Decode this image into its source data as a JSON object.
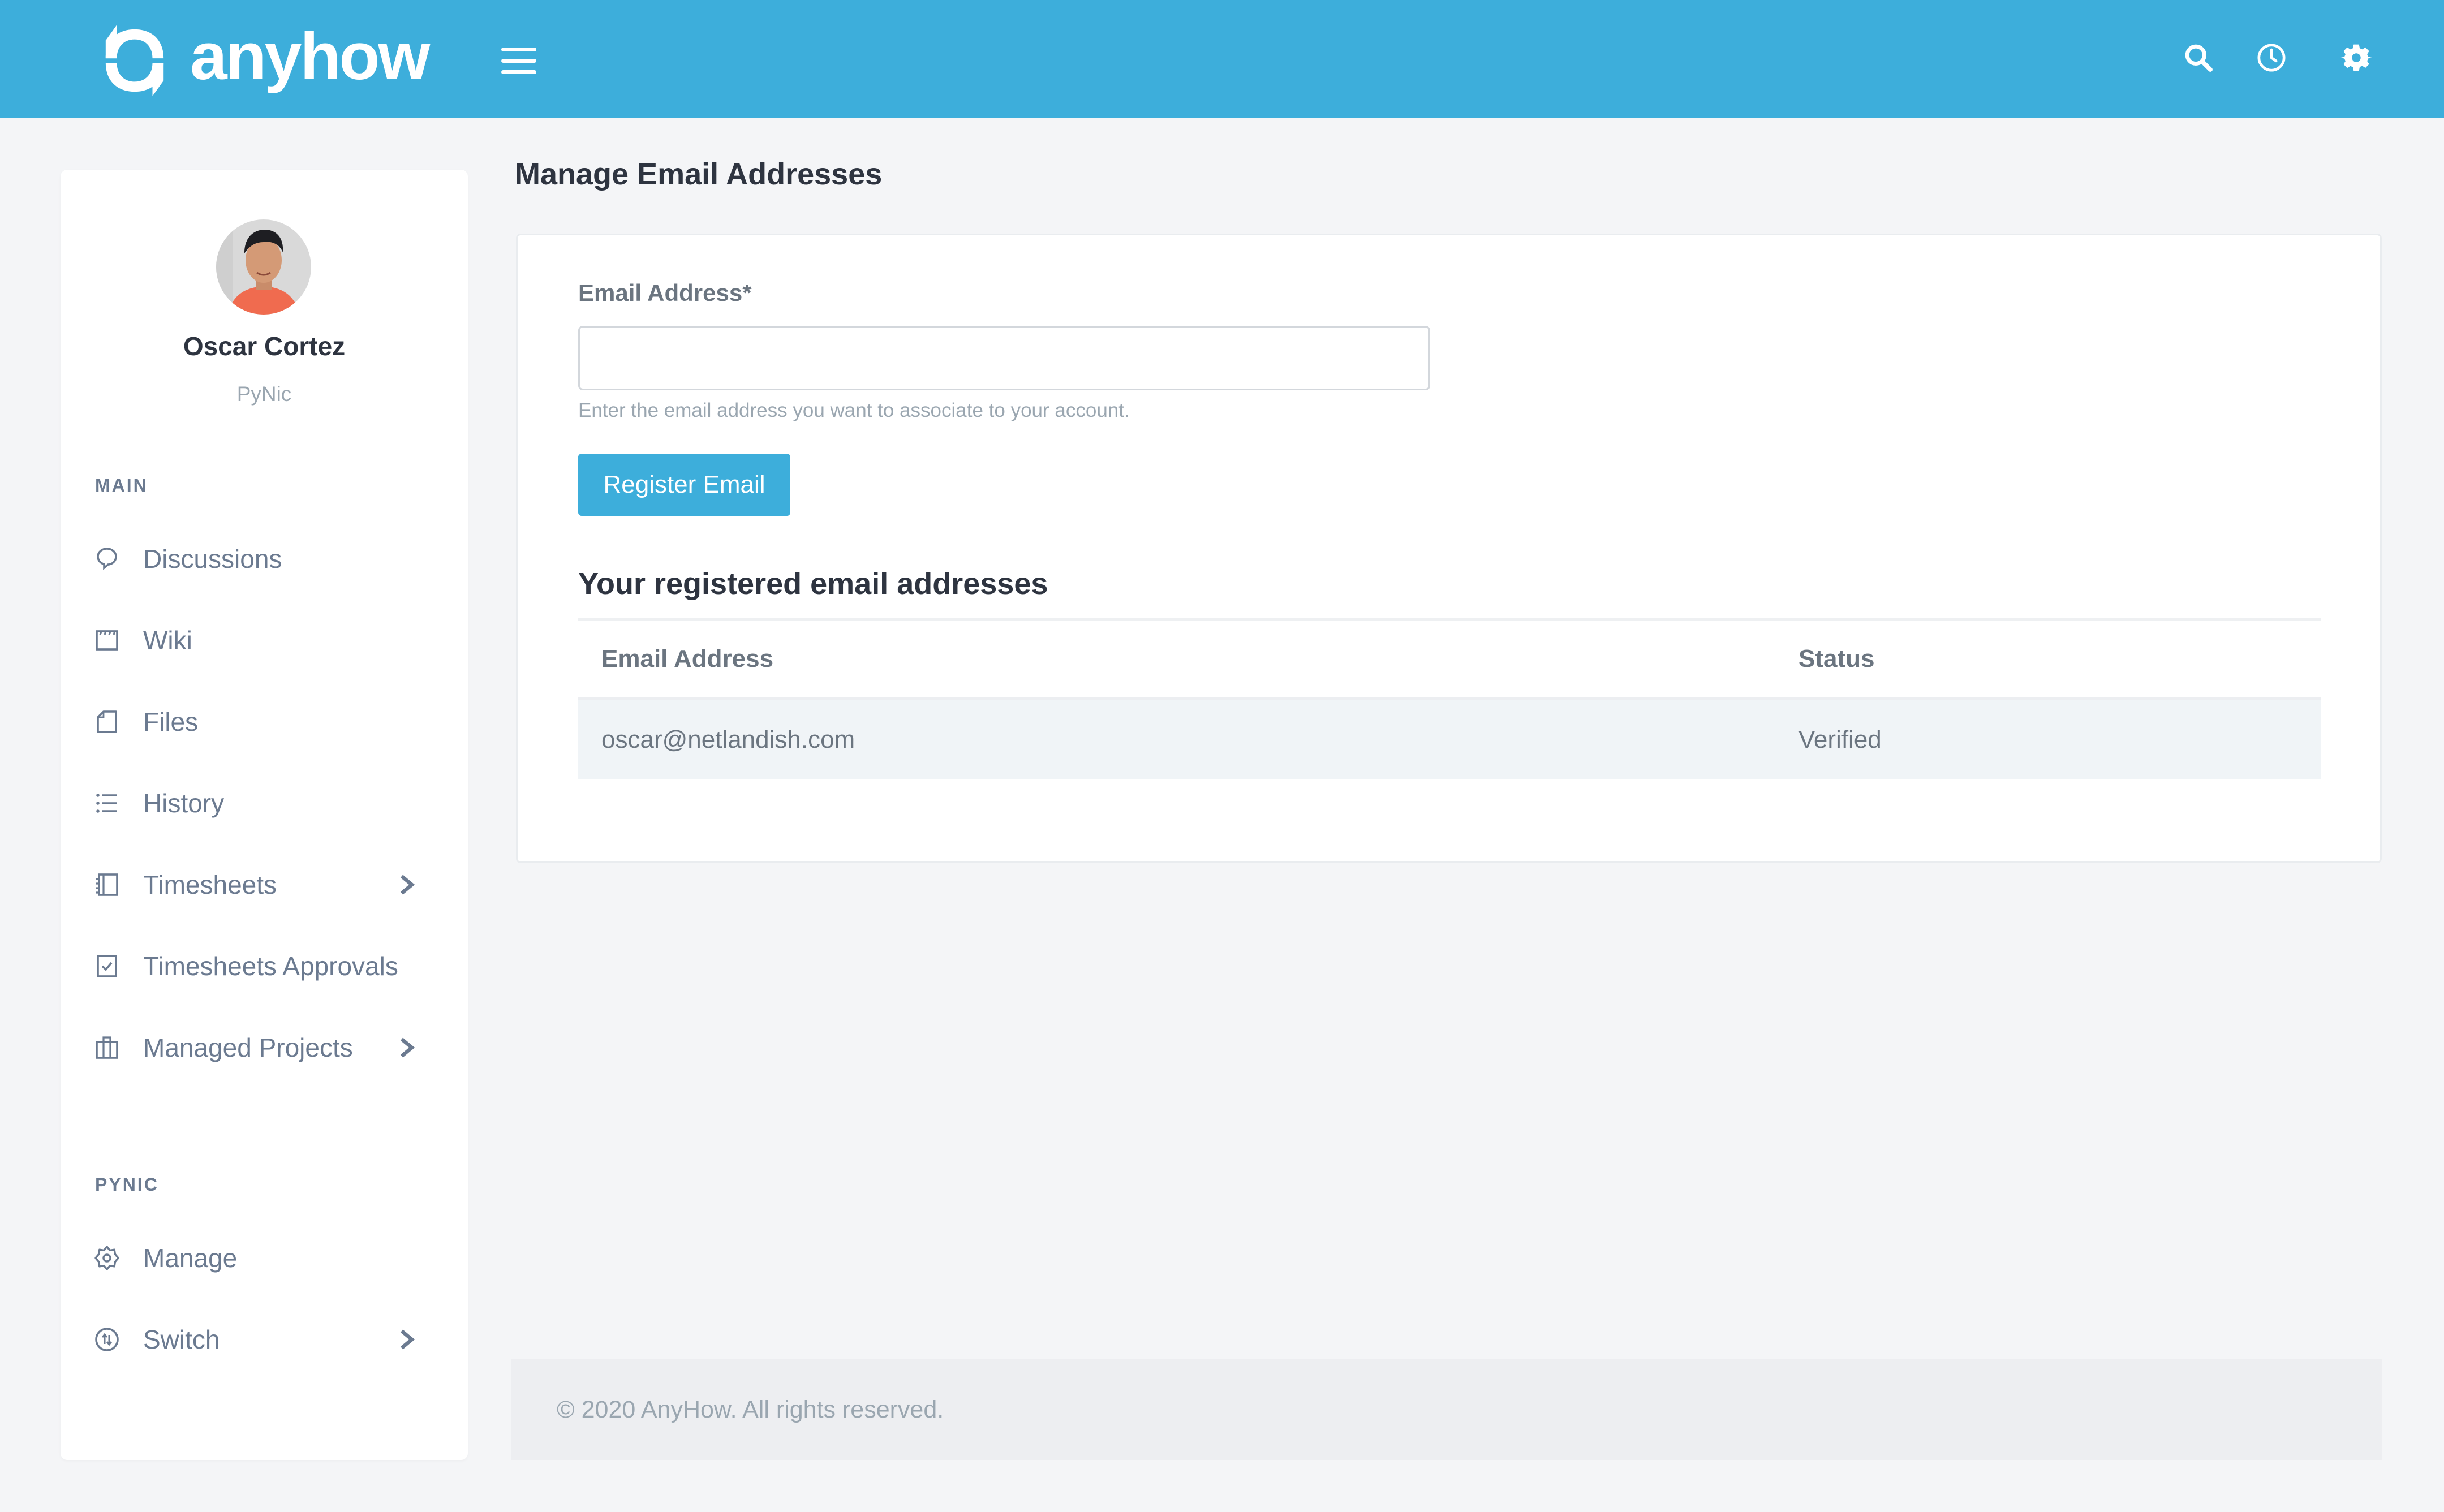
{
  "app": {
    "brand": "anyhow",
    "brand_color": "#3daedb"
  },
  "topbar": {
    "icons": [
      "search-icon",
      "clock-icon",
      "gear-icon"
    ]
  },
  "sidebar": {
    "user": {
      "name": "Oscar Cortez",
      "organization": "PyNic"
    },
    "sections": [
      {
        "label": "MAIN",
        "items": [
          {
            "label": "Discussions",
            "icon": "chat-bubble-icon",
            "has_submenu": false
          },
          {
            "label": "Wiki",
            "icon": "clapperboard-icon",
            "has_submenu": false
          },
          {
            "label": "Files",
            "icon": "file-icon",
            "has_submenu": false
          },
          {
            "label": "History",
            "icon": "list-icon",
            "has_submenu": false
          },
          {
            "label": "Timesheets",
            "icon": "notebook-icon",
            "has_submenu": true
          },
          {
            "label": "Timesheets Approvals",
            "icon": "checkbox-icon",
            "has_submenu": false
          },
          {
            "label": "Managed Projects",
            "icon": "briefcase-icon",
            "has_submenu": true
          }
        ]
      },
      {
        "label": "PYNIC",
        "items": [
          {
            "label": "Manage",
            "icon": "cog-icon",
            "has_submenu": false
          },
          {
            "label": "Switch",
            "icon": "switch-arrows-icon",
            "has_submenu": true
          }
        ]
      }
    ]
  },
  "main": {
    "page_title": "Manage Email Addresses",
    "form": {
      "email_label": "Email Address*",
      "email_value": "",
      "email_placeholder": "",
      "help_text": "Enter the email address you want to associate to your account.",
      "submit_label": "Register Email"
    },
    "registered": {
      "title": "Your registered email addresses",
      "columns": [
        "Email Address",
        "Status"
      ],
      "rows": [
        {
          "email": "oscar@netlandish.com",
          "status": "Verified"
        }
      ]
    }
  },
  "footer": {
    "text": "© 2020 AnyHow. All rights reserved."
  }
}
